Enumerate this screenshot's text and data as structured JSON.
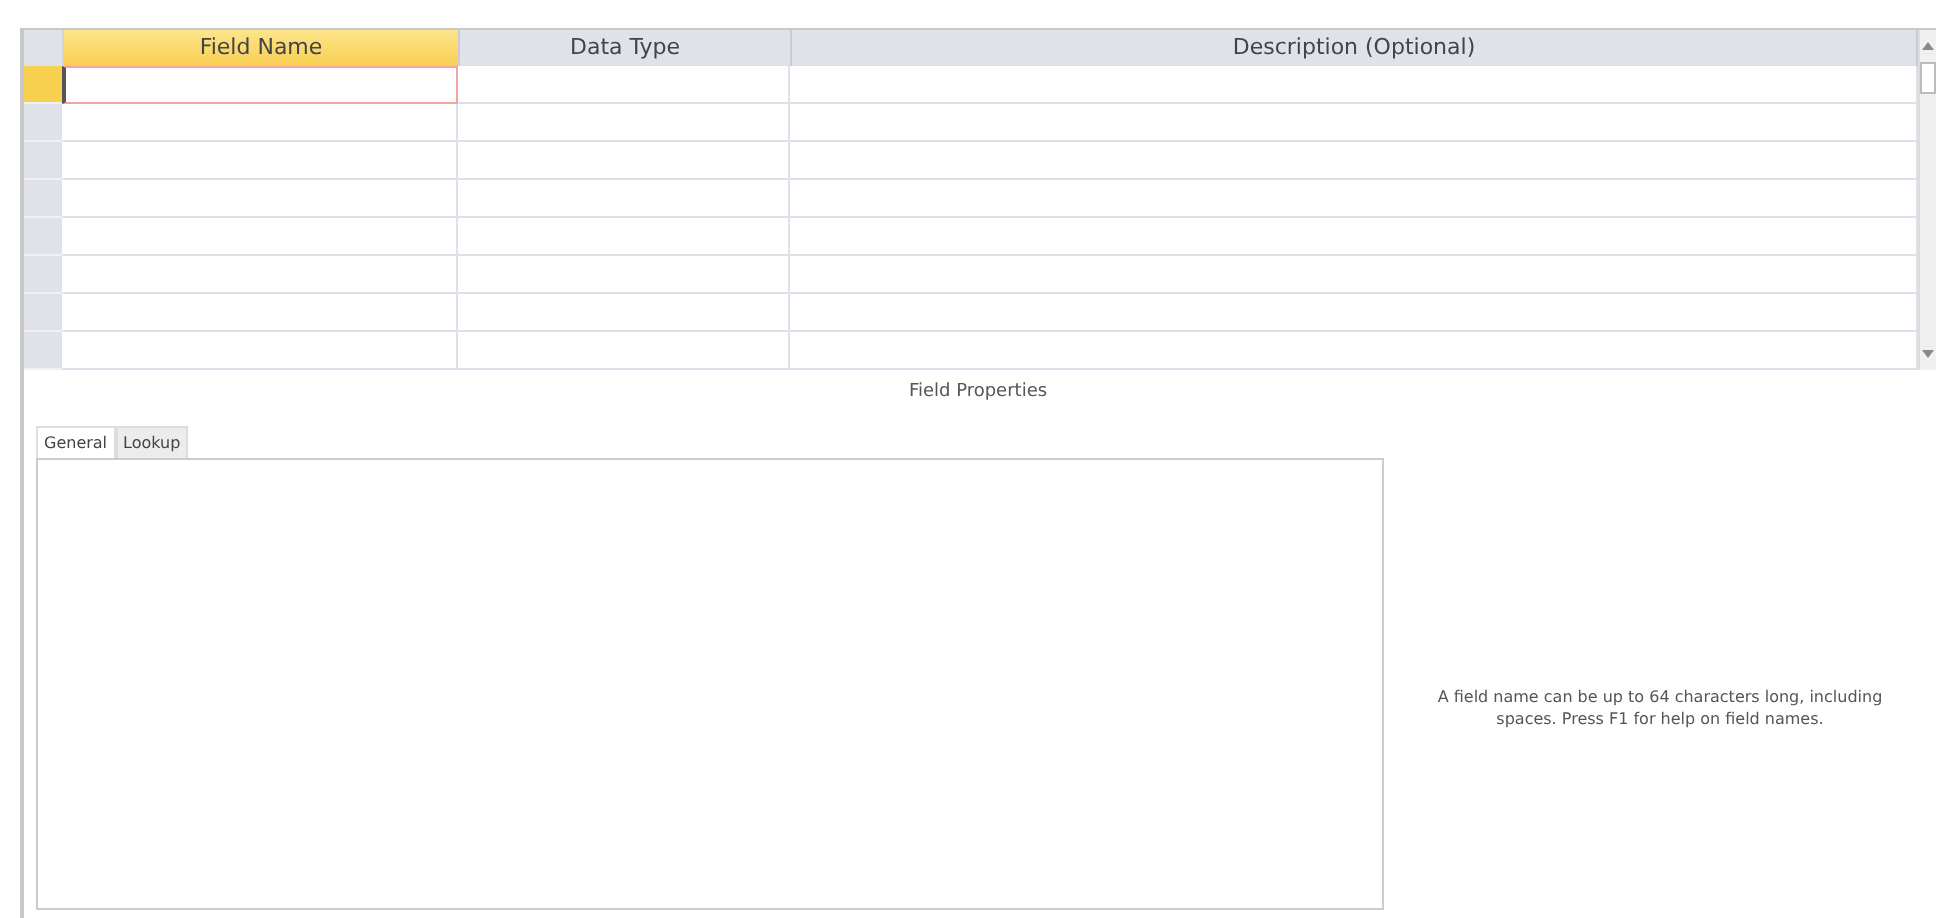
{
  "table": {
    "columns": [
      {
        "label": "Field Name",
        "selected": true
      },
      {
        "label": "Data Type",
        "selected": false
      },
      {
        "label": "Description (Optional)",
        "selected": false
      }
    ],
    "rows": [
      {
        "selected": true
      },
      {
        "selected": false
      },
      {
        "selected": false
      },
      {
        "selected": false
      },
      {
        "selected": false
      },
      {
        "selected": false
      },
      {
        "selected": false
      },
      {
        "selected": false
      }
    ]
  },
  "field_properties": {
    "title": "Field Properties",
    "tabs": [
      {
        "label": "General",
        "selected": true
      },
      {
        "label": "Lookup",
        "selected": false
      }
    ],
    "help_text": "A field name can be up to 64 characters long, including spaces. Press F1 for help on field names."
  }
}
